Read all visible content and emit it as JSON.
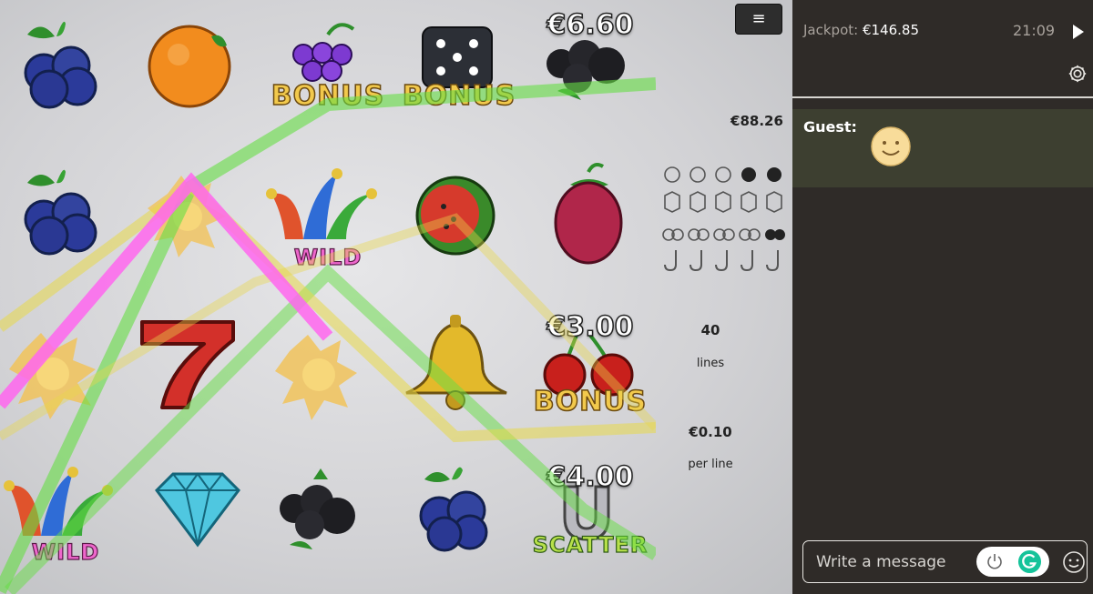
{
  "game": {
    "menu_icon": "hamburger-menu-icon",
    "reels": [
      [
        "blueberries",
        "blueberries",
        "explosion",
        "wild-jester"
      ],
      [
        "orange",
        "explosion",
        "seven",
        "diamond"
      ],
      [
        "grapes-bonus",
        "wild-jester",
        "explosion",
        "blackberries"
      ],
      [
        "dice-bonus",
        "watermelon",
        "bell",
        "blueberries"
      ],
      [
        "blackberries",
        "raspberry",
        "cherries-bonus",
        "horseshoe-scatter"
      ]
    ],
    "symbol_labels": {
      "bonus": "BONUS",
      "wild": "WILD",
      "scatter": "SCATTER"
    },
    "win_amounts": [
      "€6.60",
      "€3.00",
      "€4.00"
    ],
    "balance": "€88.26",
    "lines_value": "40",
    "lines_label": "lines",
    "bet_value": "€0.10",
    "bet_label": "per line",
    "paytable_rows": [
      {
        "symbol": "blackberry-icon",
        "count": 5,
        "highlighted": 2
      },
      {
        "symbol": "hexagon-icon",
        "count": 5,
        "highlighted": 0
      },
      {
        "symbol": "cherry-icon",
        "count": 5,
        "highlighted": 1
      },
      {
        "symbol": "jester-j-icon",
        "count": 5,
        "highlighted": 0
      }
    ],
    "payline_colors": {
      "green": "#66dd44",
      "pink": "#ff66ee",
      "yellow": "#e8d84a"
    }
  },
  "panel": {
    "jackpot_label": "Jackpot:",
    "jackpot_value": "€146.85",
    "time": "21:09",
    "chat": {
      "user": "Guest:",
      "message_icon": "smiley-emoji"
    },
    "input_placeholder": "Write a message",
    "colors": {
      "background": "#2f2b28",
      "message_row": "#3d3f30",
      "grammarly": "#15c39a"
    }
  }
}
